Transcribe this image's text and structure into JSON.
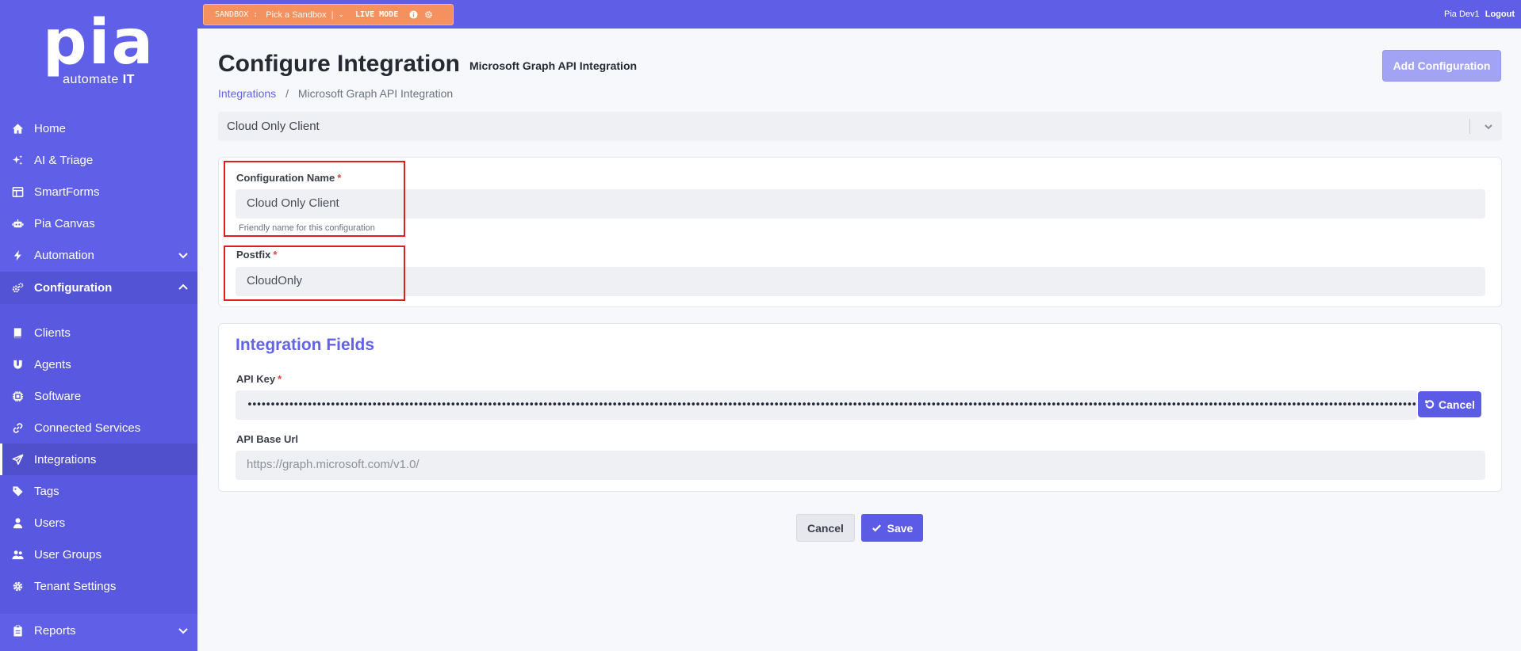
{
  "brand": {
    "logo_text": "pia",
    "tagline_prefix": "automate ",
    "tagline_bold": "IT"
  },
  "topbar": {
    "sandbox_label": "SANDBOX :",
    "sandbox_placeholder": "Pick a Sandbox",
    "sandbox_separator": "|",
    "live_mode_label": "LIVE MODE",
    "user_name": "Pia Dev1",
    "logout_label": "Logout",
    "sandbox_color": "#f4915f"
  },
  "sidebar": {
    "items": [
      {
        "label": "Home",
        "icon": "home-icon"
      },
      {
        "label": "AI & Triage",
        "icon": "sparkle-icon"
      },
      {
        "label": "SmartForms",
        "icon": "form-icon"
      },
      {
        "label": "Pia Canvas",
        "icon": "robot-icon"
      },
      {
        "label": "Automation",
        "icon": "bolt-icon",
        "expandable": true
      },
      {
        "label": "Configuration",
        "icon": "cogs-icon",
        "expanded": true
      },
      {
        "label": "Clients",
        "icon": "book-icon"
      },
      {
        "label": "Agents",
        "icon": "magnet-icon"
      },
      {
        "label": "Software",
        "icon": "chip-icon"
      },
      {
        "label": "Connected Services",
        "icon": "link-icon"
      },
      {
        "label": "Integrations",
        "icon": "send-icon",
        "active": true
      },
      {
        "label": "Tags",
        "icon": "tag-icon"
      },
      {
        "label": "Users",
        "icon": "user-icon"
      },
      {
        "label": "User Groups",
        "icon": "users-icon"
      },
      {
        "label": "Tenant Settings",
        "icon": "gear-icon"
      },
      {
        "label": "Reports",
        "icon": "clipboard-icon",
        "expandable": true
      }
    ],
    "accent_color": "#5f5fe8"
  },
  "header": {
    "title": "Configure Integration",
    "subtitle": "Microsoft Graph API Integration",
    "add_button_label": "Add Configuration"
  },
  "breadcrumb": {
    "link": "Integrations",
    "separator": "/",
    "current": "Microsoft Graph API Integration"
  },
  "config_select": {
    "value": "Cloud Only Client"
  },
  "form": {
    "config_name": {
      "label": "Configuration Name",
      "required": "*",
      "value": "Cloud Only Client",
      "hint": "Friendly name for this configuration"
    },
    "postfix": {
      "label": "Postfix",
      "required": "*",
      "value": "CloudOnly"
    }
  },
  "integration_fields": {
    "title": "Integration Fields",
    "api_key": {
      "label": "API Key",
      "required": "*",
      "value": "••••••••••••••••••••••••••••••••••••••••••••••••••••••••••••••••••••••••••••••••••••••••••••••••••••••••••••••••••••••••••••••••••••••••••••••••••••••••••••••••••••••••••••••••••••••••••••••••••••••••••••••••••••••••••••••••••••••••••••••••••••••••••••••••••••••••••••••",
      "cancel_label": "Cancel"
    },
    "api_base_url": {
      "label": "API Base Url",
      "placeholder": "https://graph.microsoft.com/v1.0/"
    }
  },
  "actions": {
    "cancel_label": "Cancel",
    "save_label": "Save"
  }
}
